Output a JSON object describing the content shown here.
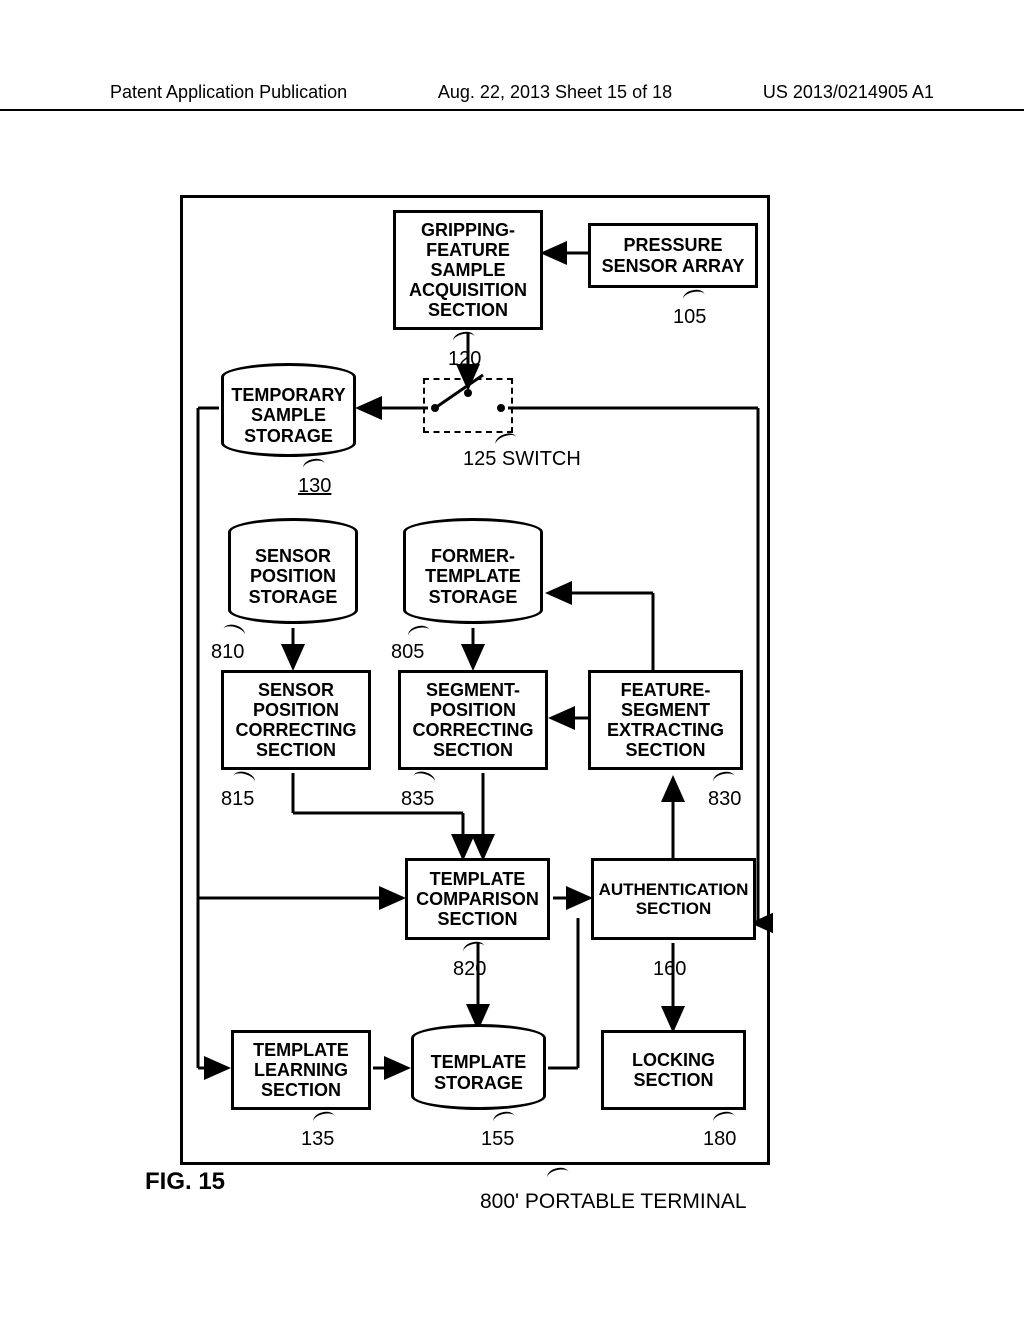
{
  "header": {
    "left": "Patent Application Publication",
    "center": "Aug. 22, 2013  Sheet 15 of 18",
    "right": "US 2013/0214905 A1"
  },
  "figure_label": "FIG. 15",
  "terminal_label": "800' PORTABLE TERMINAL",
  "blocks": {
    "gripping": {
      "l1": "GRIPPING-",
      "l2": "FEATURE",
      "l3": "SAMPLE",
      "l4": "ACQUISITION",
      "l5": "SECTION",
      "ref": "120"
    },
    "pressure": {
      "l1": "PRESSURE",
      "l2": "SENSOR ARRAY",
      "ref": "105"
    },
    "switch_ref": "125 SWITCH",
    "temp_storage": {
      "l1": "TEMPORARY",
      "l2": "SAMPLE",
      "l3": "STORAGE",
      "ref": "130"
    },
    "sensor_pos_storage": {
      "l1": "SENSOR",
      "l2": "POSITION",
      "l3": "STORAGE",
      "ref": "810"
    },
    "former_template_storage": {
      "l1": "FORMER-",
      "l2": "TEMPLATE",
      "l3": "STORAGE",
      "ref": "805"
    },
    "sensor_pos_correct": {
      "l1": "SENSOR",
      "l2": "POSITION",
      "l3": "CORRECTING",
      "l4": "SECTION",
      "ref": "815"
    },
    "segment_pos_correct": {
      "l1": "SEGMENT-",
      "l2": "POSITION",
      "l3": "CORRECTING",
      "l4": "SECTION",
      "ref": "835"
    },
    "feature_segment_extract": {
      "l1": "FEATURE-",
      "l2": "SEGMENT",
      "l3": "EXTRACTING",
      "l4": "SECTION",
      "ref": "830"
    },
    "template_compare": {
      "l1": "TEMPLATE",
      "l2": "COMPARISON",
      "l3": "SECTION",
      "ref": "820"
    },
    "authentication": {
      "l1": "AUTHENTICATION",
      "l2": "SECTION",
      "ref": "160"
    },
    "template_learning": {
      "l1": "TEMPLATE",
      "l2": "LEARNING",
      "l3": "SECTION",
      "ref": "135"
    },
    "template_storage": {
      "l1": "TEMPLATE",
      "l2": "STORAGE",
      "ref": "155"
    },
    "locking": {
      "l1": "LOCKING",
      "l2": "SECTION",
      "ref": "180"
    }
  }
}
